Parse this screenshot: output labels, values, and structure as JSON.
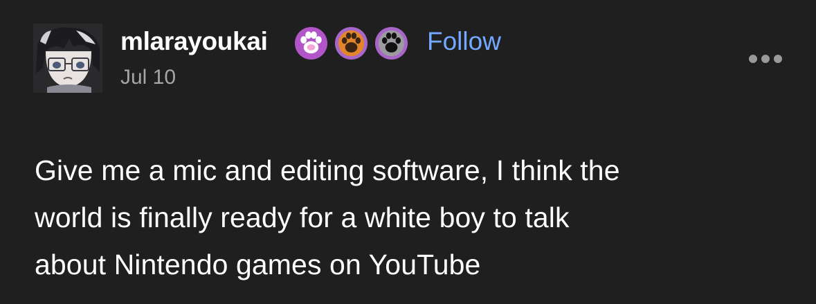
{
  "post": {
    "author": {
      "username": "mlarayoukai",
      "follow_label": "Follow",
      "timestamp": "Jul 10",
      "avatar_icon": "anime-avatar-icon",
      "badges": [
        {
          "icon": "paw-badge-icon",
          "color": "#c060c8"
        },
        {
          "icon": "paw-badge-icon",
          "color": "#e0862a"
        },
        {
          "icon": "paw-badge-icon",
          "color": "#9a9a9a"
        }
      ]
    },
    "menu_icon": "more-options-icon",
    "body": {
      "line1": "Give me a mic and editing software, I think the",
      "line2": "world is finally ready for a white boy to talk",
      "line3": "about Nintendo games on YouTube"
    }
  },
  "colors": {
    "background": "#1f1f20",
    "text": "#ffffff",
    "follow": "#73a9ff",
    "muted": "#a6a6a8"
  }
}
